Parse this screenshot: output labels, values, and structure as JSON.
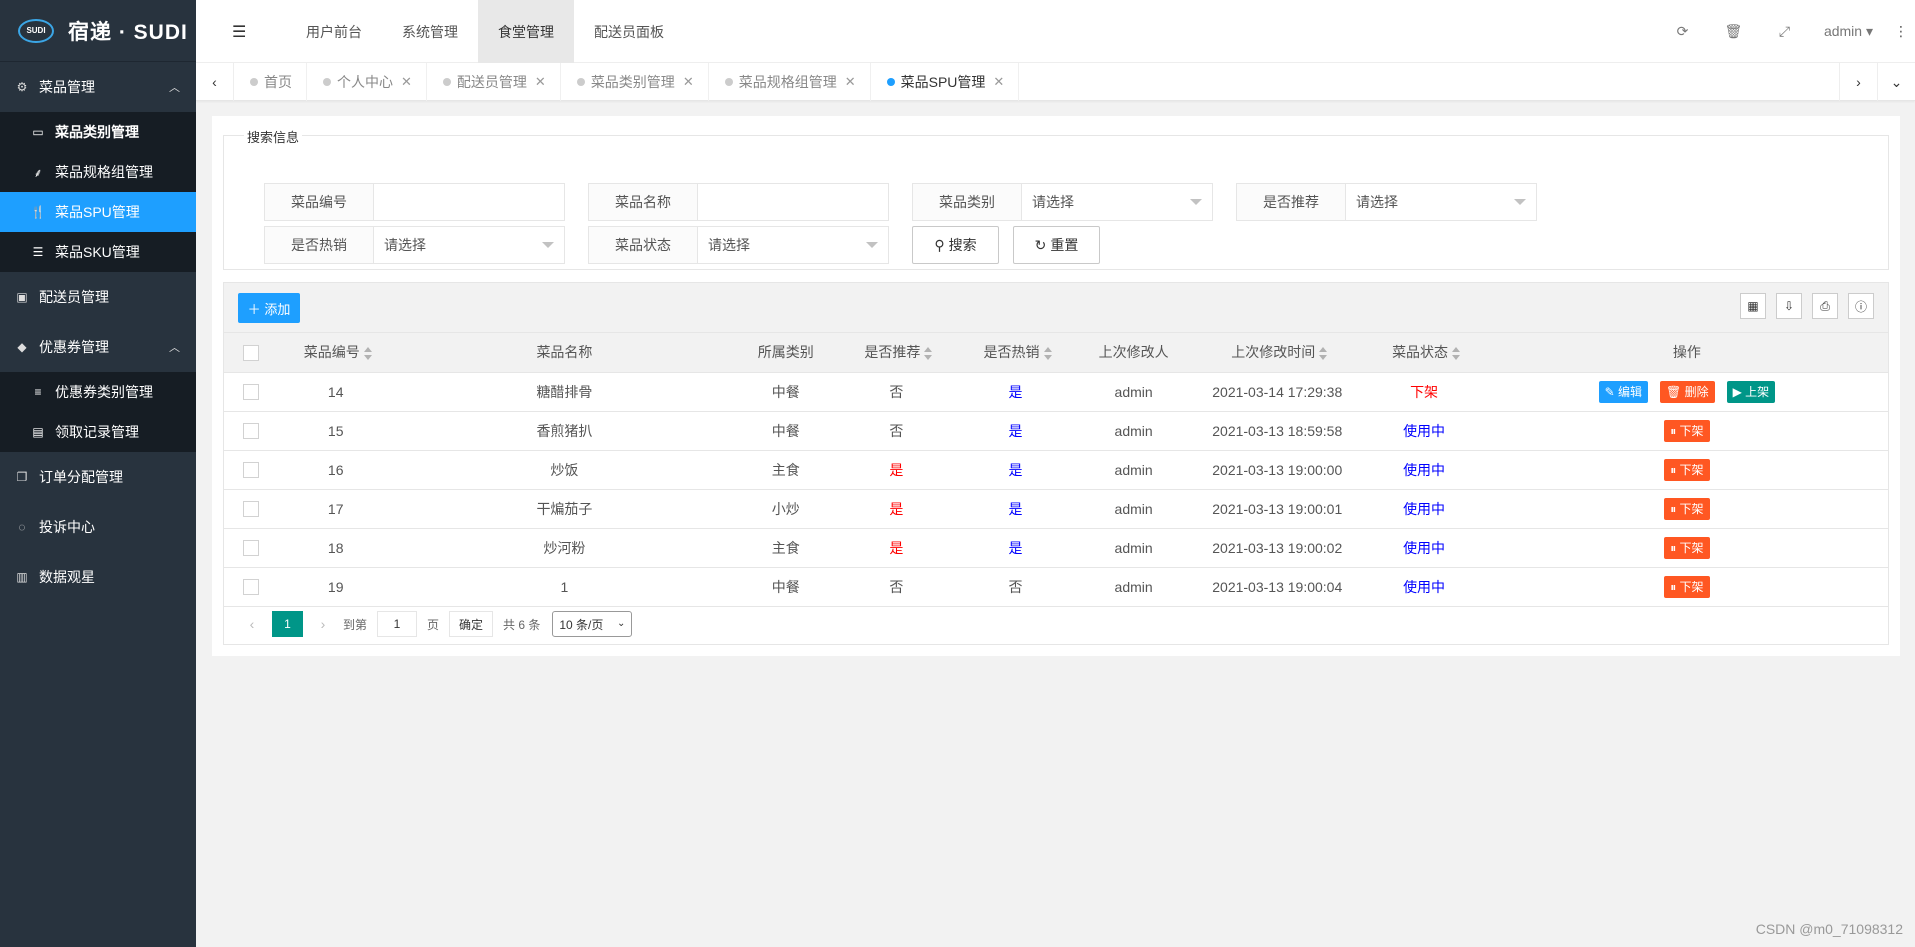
{
  "brand": {
    "badge": "SUDI",
    "title": "宿递 · SUDI"
  },
  "sidebar": {
    "groups": [
      {
        "label": "菜品管理",
        "icon": "gears-icon",
        "items": [
          {
            "label": "菜品类别管理",
            "icon": "inbox-icon"
          },
          {
            "label": "菜品规格组管理",
            "icon": "sitemap-icon"
          },
          {
            "label": "菜品SPU管理",
            "icon": "cutlery-icon"
          },
          {
            "label": "菜品SKU管理",
            "icon": "server-icon"
          }
        ]
      },
      {
        "label": "配送员管理",
        "icon": "bag-icon"
      },
      {
        "label": "优惠券管理",
        "icon": "tag-icon",
        "items": [
          {
            "label": "优惠券类别管理",
            "icon": "list-icon"
          },
          {
            "label": "领取记录管理",
            "icon": "card-icon"
          }
        ]
      },
      {
        "label": "订单分配管理",
        "icon": "copy-icon"
      },
      {
        "label": "投诉中心",
        "icon": "chat-icon"
      },
      {
        "label": "数据观星",
        "icon": "bar-chart-icon"
      }
    ]
  },
  "topnav": {
    "items": [
      "用户前台",
      "系统管理",
      "食堂管理",
      "配送员面板"
    ],
    "active": "食堂管理",
    "user": "admin"
  },
  "tabs": [
    "首页",
    "个人中心",
    "配送员管理",
    "菜品类别管理",
    "菜品规格组管理",
    "菜品SPU管理"
  ],
  "search": {
    "legend": "搜索信息",
    "fields": {
      "code": {
        "label": "菜品编号",
        "value": ""
      },
      "name": {
        "label": "菜品名称",
        "value": ""
      },
      "category": {
        "label": "菜品类别",
        "value": "请选择"
      },
      "recommend": {
        "label": "是否推荐",
        "value": "请选择"
      },
      "hot": {
        "label": "是否热销",
        "value": "请选择"
      },
      "status": {
        "label": "菜品状态",
        "value": "请选择"
      }
    },
    "search_btn": "搜索",
    "reset_btn": "重置"
  },
  "table": {
    "add_btn": "添加",
    "headers": {
      "code": "菜品编号",
      "name": "菜品名称",
      "category": "所属类别",
      "recommend": "是否推荐",
      "hot": "是否热销",
      "modifier": "上次修改人",
      "time": "上次修改时间",
      "status": "菜品状态",
      "ops": "操作"
    },
    "rows": [
      {
        "code": "14",
        "name": "糖醋排骨",
        "category": "中餐",
        "recommend": "否",
        "hot": "是",
        "modifier": "admin",
        "time": "2021-03-14 17:29:38",
        "status": "下架"
      },
      {
        "code": "15",
        "name": "香煎猪扒",
        "category": "中餐",
        "recommend": "否",
        "hot": "是",
        "modifier": "admin",
        "time": "2021-03-13 18:59:58",
        "status": "使用中"
      },
      {
        "code": "16",
        "name": "炒饭",
        "category": "主食",
        "recommend": "是",
        "hot": "是",
        "modifier": "admin",
        "time": "2021-03-13 19:00:00",
        "status": "使用中"
      },
      {
        "code": "17",
        "name": "干煸茄子",
        "category": "小炒",
        "recommend": "是",
        "hot": "是",
        "modifier": "admin",
        "time": "2021-03-13 19:00:01",
        "status": "使用中"
      },
      {
        "code": "18",
        "name": "炒河粉",
        "category": "主食",
        "recommend": "是",
        "hot": "是",
        "modifier": "admin",
        "time": "2021-03-13 19:00:02",
        "status": "使用中"
      },
      {
        "code": "19",
        "name": "1",
        "category": "中餐",
        "recommend": "否",
        "hot": "否",
        "modifier": "admin",
        "time": "2021-03-13 19:00:04",
        "status": "使用中"
      }
    ],
    "ops": {
      "edit": "编辑",
      "delete": "删除",
      "on": "上架",
      "off": "下架"
    }
  },
  "pager": {
    "current": "1",
    "goto": "到第",
    "page_input": "1",
    "page_unit": "页",
    "confirm": "确定",
    "total": "共 6 条",
    "per_page": "10 条/页"
  },
  "watermark": "CSDN @m0_71098312",
  "colors": {
    "accent": "#1e9fff",
    "sidebar": "#28333e",
    "danger": "#ff5722",
    "teal": "#009688",
    "red_text": "#ff0000",
    "blue_text": "#0000ff"
  }
}
